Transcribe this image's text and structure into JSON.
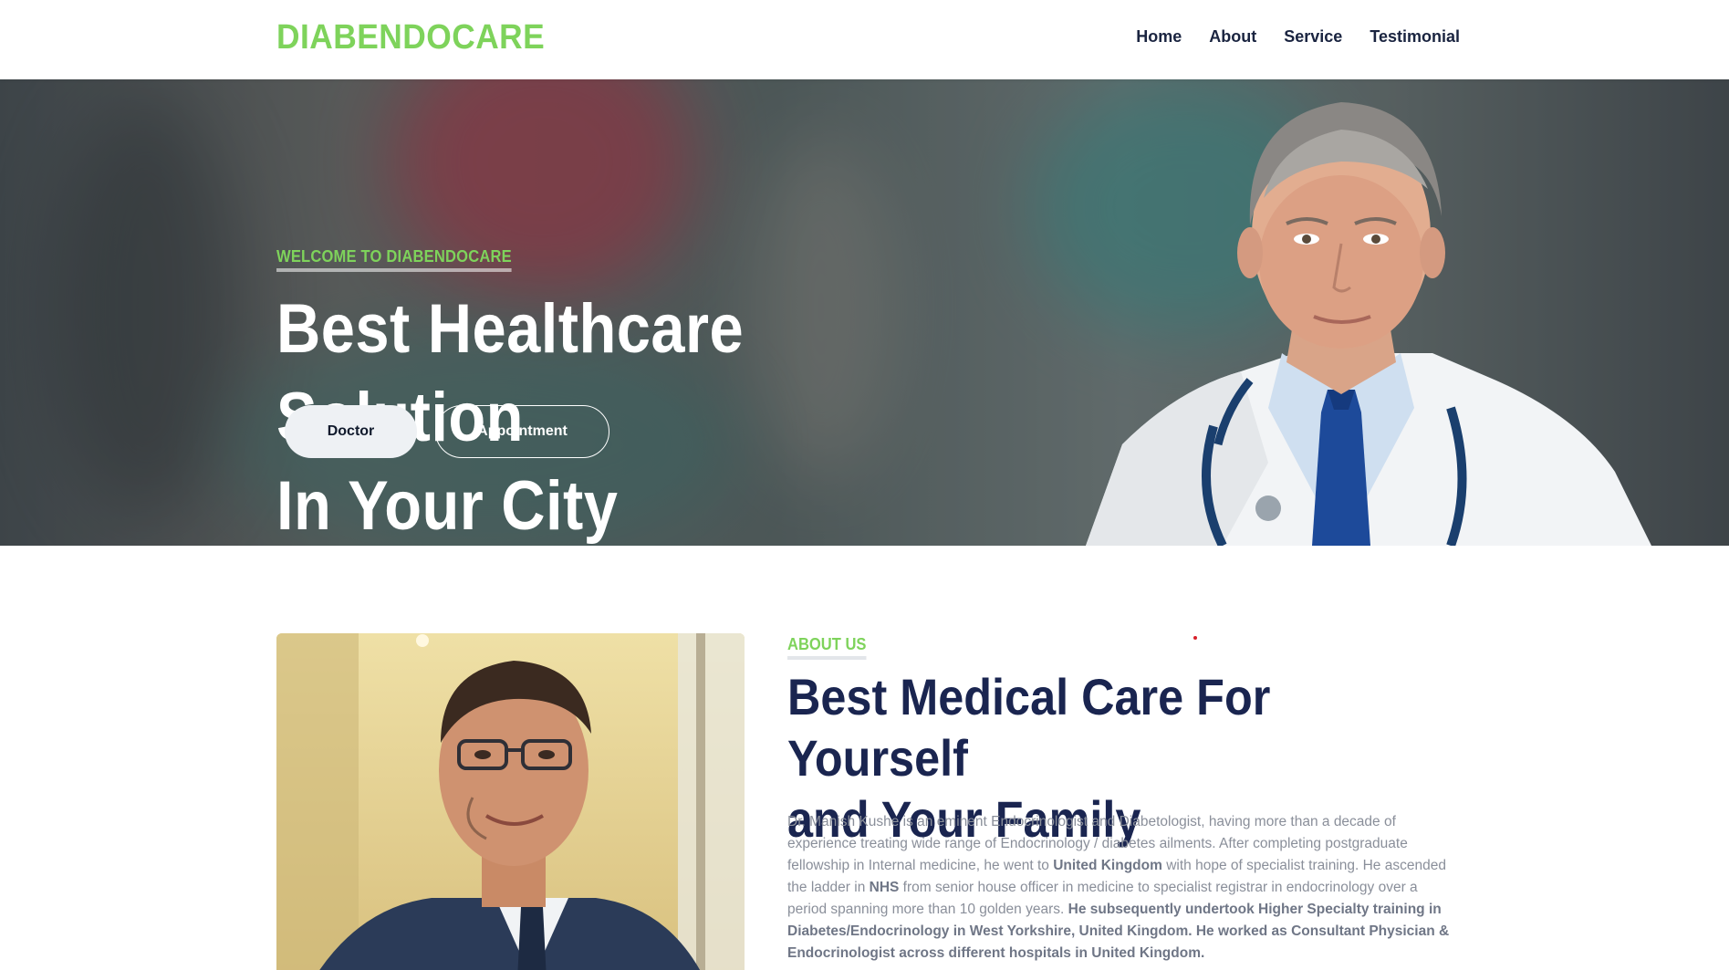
{
  "nav": {
    "brand": "DIABENDOCARE",
    "links": [
      "Home",
      "About",
      "Service",
      "Testimonial"
    ]
  },
  "hero": {
    "eyebrow": "WELCOME TO DIABENDOCARE",
    "title_line1": "Best Healthcare Solution",
    "title_line2": "In Your City",
    "btn_doctor": "Doctor",
    "btn_appointment": "Appointment"
  },
  "about": {
    "eyebrow": "ABOUT US",
    "title_line1": "Best Medical Care For Yourself",
    "title_line2": "and Your Family",
    "p1": "Dr. Manish Kushe is an eminent Endocrinologist and Diabetologist, having more than a decade of experience treating wide range of Endocrinology / diabetes ailments. After completing postgraduate fellowship in Internal medicine, he went to ",
    "b1": "United Kingdom",
    "p2": " with hope of specialist training. He ascended the ladder in ",
    "b2": "NHS",
    "p3": " from senior house officer in medicine to specialist registrar in endocrinology over a period spanning more than 10 golden years. ",
    "b3": "He subsequently undertook Higher Specialty training in Diabetes/Endocrinology in West Yorkshire, United Kingdom. He worked as Consultant Physician & Endocrinologist across different hospitals in United Kingdom."
  },
  "colors": {
    "accent": "#7ed35b",
    "navy": "#1a2550",
    "text_muted": "#8a8f9a"
  }
}
